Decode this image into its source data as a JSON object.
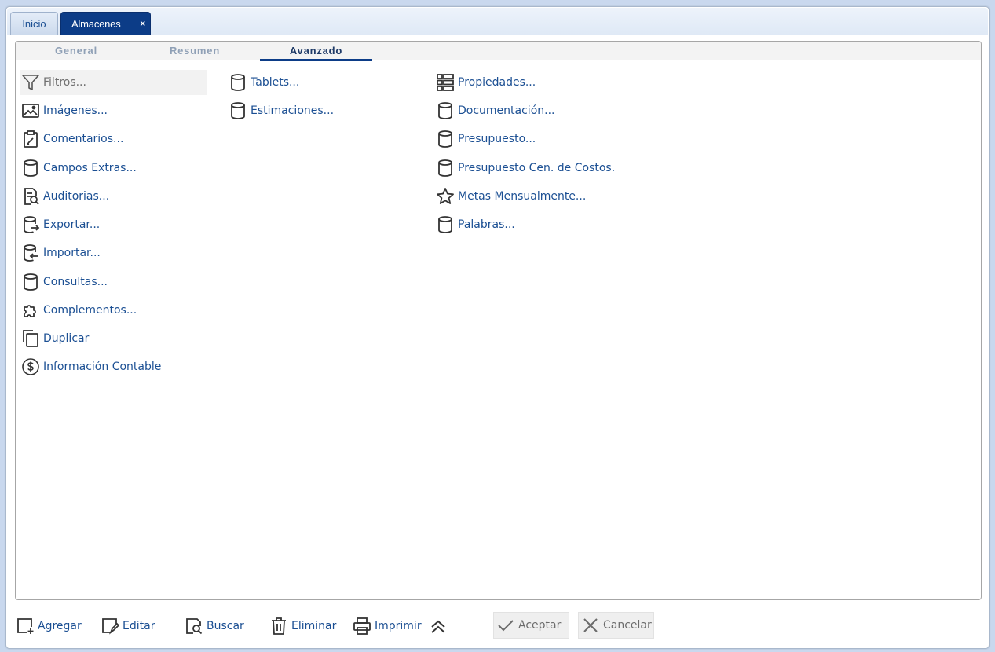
{
  "tabs": [
    {
      "label": "Inicio"
    },
    {
      "label": "Almacenes",
      "close": "×"
    }
  ],
  "subtabs": [
    {
      "label": "General"
    },
    {
      "label": "Resumen"
    },
    {
      "label": "Avanzado"
    }
  ],
  "active_subtab": "Avanzado",
  "menu": {
    "col1": [
      {
        "label": "Filtros...",
        "icon": "filter-icon",
        "placeholder": true
      },
      {
        "label": "Imágenes...",
        "icon": "image-icon"
      },
      {
        "label": "Comentarios...",
        "icon": "clipboard-edit-icon"
      },
      {
        "label": "Campos Extras...",
        "icon": "database-icon"
      },
      {
        "label": "Auditorias...",
        "icon": "audit-search-icon"
      },
      {
        "label": "Exportar...",
        "icon": "database-export-icon"
      },
      {
        "label": "Importar...",
        "icon": "database-import-icon"
      },
      {
        "label": "Consultas...",
        "icon": "database-icon"
      },
      {
        "label": "Complementos...",
        "icon": "puzzle-icon"
      },
      {
        "label": "Duplicar",
        "icon": "copy-icon"
      },
      {
        "label": "Información Contable",
        "icon": "dollar-circle-icon"
      }
    ],
    "col2": [
      {
        "label": "Tablets...",
        "icon": "database-icon"
      },
      {
        "label": "Estimaciones...",
        "icon": "database-icon"
      }
    ],
    "col3": [
      {
        "label": "Propiedades...",
        "icon": "properties-list-icon"
      },
      {
        "label": "Documentación...",
        "icon": "database-icon"
      },
      {
        "label": "Presupuesto...",
        "icon": "database-icon"
      },
      {
        "label": "Presupuesto Cen. de Costos.",
        "icon": "database-icon"
      },
      {
        "label": "Metas Mensualmente...",
        "icon": "star-icon"
      },
      {
        "label": "Palabras...",
        "icon": "database-icon"
      }
    ]
  },
  "toolbar": {
    "add": "Agregar",
    "edit": "Editar",
    "search": "Buscar",
    "delete": "Eliminar",
    "print": "Imprimir",
    "collapse_icon": "double-chevron-up-icon",
    "accept": "Aceptar",
    "cancel": "Cancelar"
  },
  "colors": {
    "accent": "#0c3c87",
    "link": "#1b4f93",
    "disabled_text": "#6b6b6b"
  }
}
